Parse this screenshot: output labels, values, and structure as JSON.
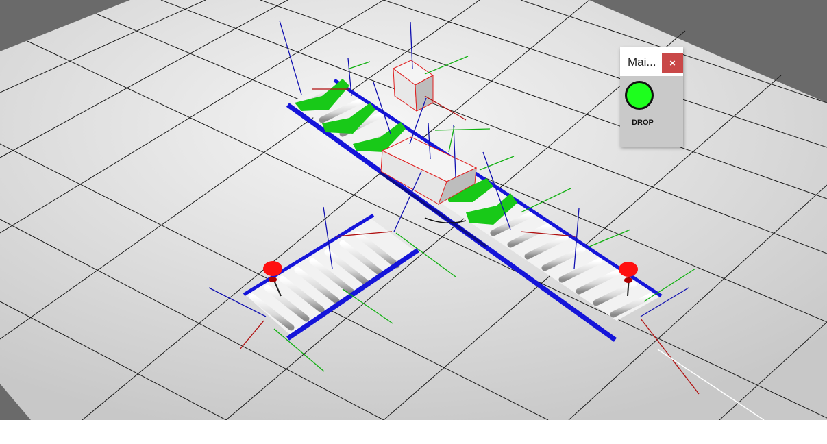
{
  "panel": {
    "title": "Mai...",
    "close_label": "×",
    "indicator": {
      "label": "DROP",
      "state": "on",
      "color": "#1dff1d"
    }
  },
  "scene": {
    "floor_color": "#dcdcdc",
    "background_color": "#6a6a6a",
    "accent_colors": {
      "conveyor_frame": "#1515d9",
      "sensor": "#ff0000",
      "arrow": "#18c918"
    }
  }
}
